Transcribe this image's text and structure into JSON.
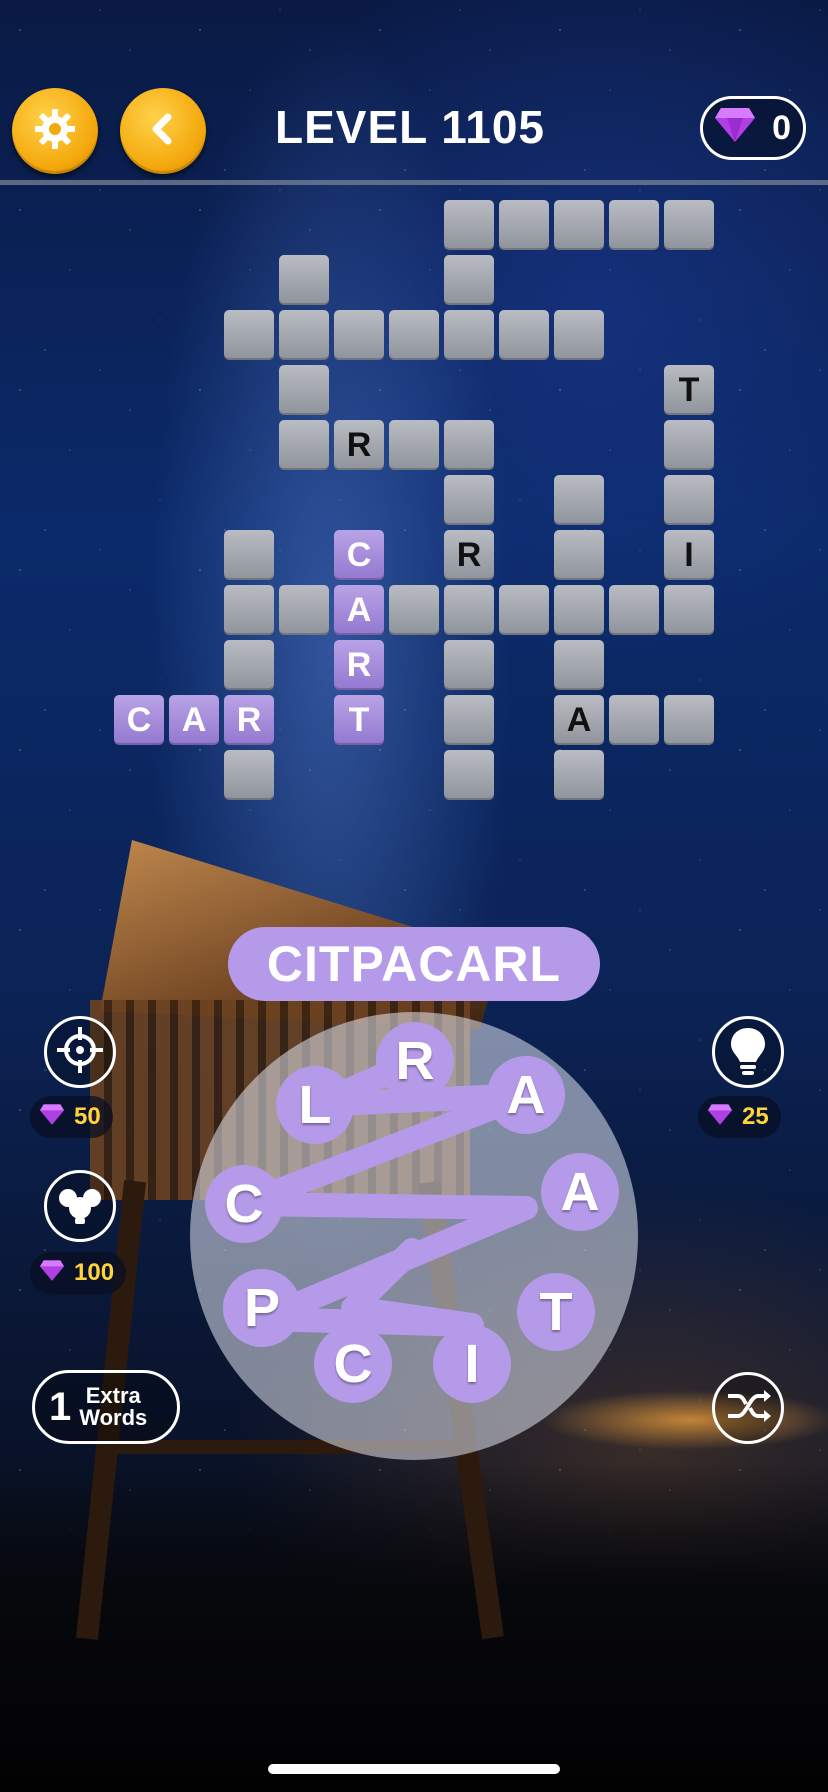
{
  "header": {
    "level_label": "LEVEL 1105",
    "gem_count": "0",
    "settings_icon": "gear-icon",
    "back_icon": "chevron-left-icon",
    "gem_icon": "purple-gem-icon"
  },
  "grid": {
    "revealed_letters": [
      {
        "letter": "T",
        "state": "hint"
      },
      {
        "letter": "R",
        "state": "hint"
      },
      {
        "letter": "C",
        "state": "found"
      },
      {
        "letter": "R",
        "state": "hint"
      },
      {
        "letter": "I",
        "state": "hint"
      },
      {
        "letter": "A",
        "state": "found"
      },
      {
        "letter": "R",
        "state": "found"
      },
      {
        "letter": "C",
        "state": "found"
      },
      {
        "letter": "A",
        "state": "found"
      },
      {
        "letter": "R",
        "state": "found"
      },
      {
        "letter": "T",
        "state": "found"
      },
      {
        "letter": "A",
        "state": "hint"
      }
    ]
  },
  "preview_word": "CITPACARL",
  "wheel": {
    "letters": [
      "R",
      "A",
      "A",
      "T",
      "I",
      "C",
      "P",
      "C",
      "L"
    ],
    "selected_path": [
      "C",
      "I",
      "T",
      "P",
      "A",
      "C",
      "A",
      "R",
      "L"
    ]
  },
  "side": {
    "target_hint": {
      "icon": "crosshair-icon",
      "cost": "50"
    },
    "bulb_hint": {
      "icon": "lightbulb-icon",
      "cost": "25"
    },
    "multi_hint": {
      "icon": "multi-bulb-icon",
      "cost": "100"
    },
    "extra_words": {
      "count": "1",
      "line1": "Extra",
      "line2": "Words"
    },
    "shuffle": {
      "icon": "shuffle-icon"
    }
  },
  "colors": {
    "accent": "#b59ae9",
    "coin": "#f4a80c",
    "cost_text": "#ffd43b"
  }
}
